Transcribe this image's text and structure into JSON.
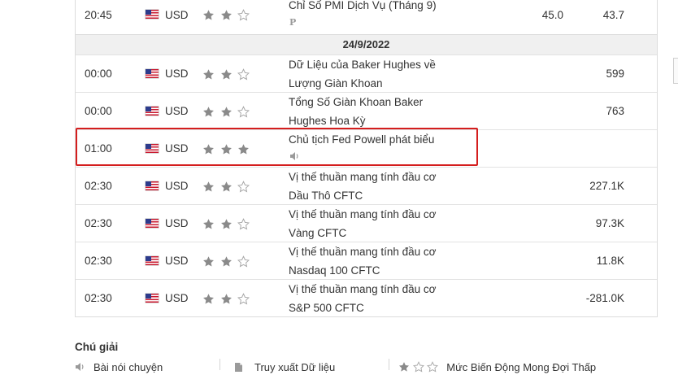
{
  "rows": [
    {
      "time": "20:45",
      "currency": "USD",
      "stars": 2,
      "event": "Chỉ Số PMI Dịch Vụ (Tháng 9)",
      "badge": "P",
      "previous": "45.0",
      "actual": "43.7"
    },
    {
      "time": "00:00",
      "currency": "USD",
      "stars": 2,
      "event_line1": "Dữ Liệu của Baker Hughes về",
      "event_line2": "Lượng Giàn Khoan",
      "actual": "599"
    },
    {
      "time": "00:00",
      "currency": "USD",
      "stars": 2,
      "event_line1": "Tổng Số Giàn Khoan Baker",
      "event_line2": "Hughes Hoa Kỳ",
      "actual": "763"
    },
    {
      "time": "01:00",
      "currency": "USD",
      "stars": 3,
      "event": "Chủ tịch Fed Powell phát biểu",
      "icon": "speaker-icon"
    },
    {
      "time": "02:30",
      "currency": "USD",
      "stars": 2,
      "event_line1": "Vị thế thuần mang tính đầu cơ",
      "event_line2": "Dầu Thô CFTC",
      "actual": "227.1K"
    },
    {
      "time": "02:30",
      "currency": "USD",
      "stars": 2,
      "event_line1": "Vị thế thuần mang tính đầu cơ",
      "event_line2": "Vàng CFTC",
      "actual": "97.3K"
    },
    {
      "time": "02:30",
      "currency": "USD",
      "stars": 2,
      "event_line1": "Vị thế thuần mang tính đầu cơ",
      "event_line2": "Nasdaq 100 CFTC",
      "actual": "11.8K"
    },
    {
      "time": "02:30",
      "currency": "USD",
      "stars": 2,
      "event_line1": "Vị thế thuần mang tính đầu cơ",
      "event_line2": "S&P 500 CFTC",
      "actual": "-281.0K"
    }
  ],
  "date_header": "24/9/2022",
  "legend": {
    "title": "Chú giải",
    "speech": "Bài nói chuyện",
    "data_retrieval": "Truy xuất Dữ liệu",
    "low_volatility": "Mức Biến Động Mong Đợi Thấp"
  },
  "colors": {
    "highlight": "#d41e1e",
    "star_filled": "#8a8a8a",
    "date_band": "#f0f0f0"
  }
}
